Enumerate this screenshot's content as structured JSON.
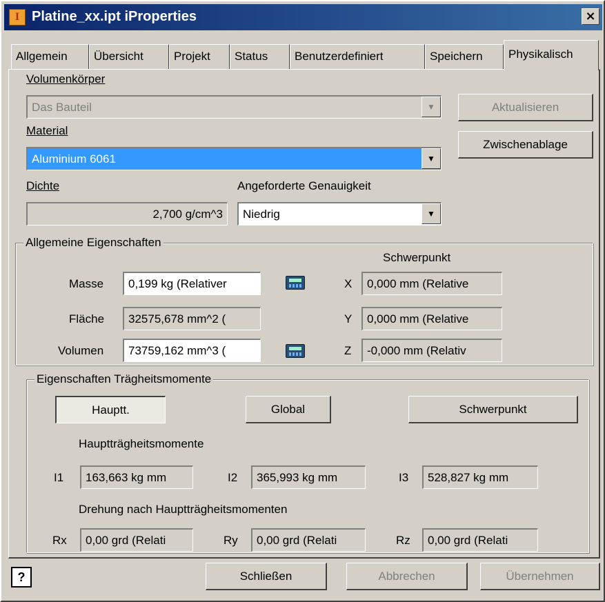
{
  "window": {
    "title": "Platine_xx.ipt iProperties",
    "close_glyph": "×",
    "app_icon_letter": "I"
  },
  "tabs": [
    "Allgemein",
    "Übersicht",
    "Projekt",
    "Status",
    "Benutzerdefiniert",
    "Speichern",
    "Physikalisch"
  ],
  "active_tab": "Physikalisch",
  "solid": {
    "label": "Volumenkörper",
    "value": "Das Bauteil"
  },
  "buttons": {
    "update": "Aktualisieren",
    "clipboard": "Zwischenablage"
  },
  "material": {
    "label": "Material",
    "value": "Aluminium 6061"
  },
  "density": {
    "label": "Dichte",
    "value": "2,700 g/cm^3"
  },
  "accuracy": {
    "label": "Angeforderte Genauigkeit",
    "value": "Niedrig"
  },
  "general": {
    "title": "Allgemeine Eigenschaften",
    "mass_label": "Masse",
    "mass_value": "0,199 kg (Relativer",
    "area_label": "Fläche",
    "area_value": "32575,678 mm^2 (",
    "volume_label": "Volumen",
    "volume_value": "73759,162 mm^3 (",
    "centroid_title": "Schwerpunkt",
    "x_label": "X",
    "x_value": "0,000 mm (Relative",
    "y_label": "Y",
    "y_value": "0,000 mm (Relative",
    "z_label": "Z",
    "z_value": "-0,000 mm (Relativ"
  },
  "inertia": {
    "title": "Eigenschaften Trägheitsmomente",
    "btn_principal": "Hauptt.",
    "btn_global": "Global",
    "btn_centroid": "Schwerpunkt",
    "principal_title": "Hauptträgheitsmomente",
    "i1_label": "I1",
    "i1_value": "163,663 kg mm",
    "i2_label": "I2",
    "i2_value": "365,993 kg mm",
    "i3_label": "I3",
    "i3_value": "528,827 kg mm",
    "rotation_title": "Drehung nach Hauptträgheitsmomenten",
    "rx_label": "Rx",
    "rx_value": "0,00 grd (Relati",
    "ry_label": "Ry",
    "ry_value": "0,00 grd (Relati",
    "rz_label": "Rz",
    "rz_value": "0,00 grd (Relati"
  },
  "footer": {
    "help_glyph": "?",
    "close": "Schließen",
    "cancel": "Abbrechen",
    "apply": "Übernehmen"
  },
  "icons": [
    "app-icon",
    "close-icon",
    "dropdown-arrow-icon",
    "calculator-icon",
    "help-icon"
  ]
}
